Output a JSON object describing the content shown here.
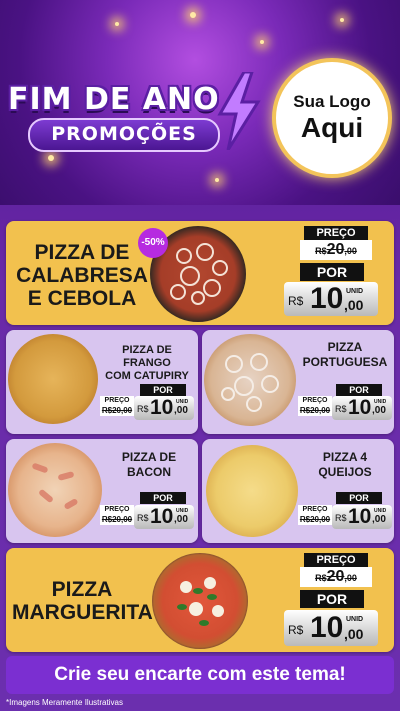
{
  "header": {
    "title_line1": "FIM DE ANO",
    "title_line2": "PROMOÇÕES",
    "logo_line1": "Sua Logo",
    "logo_line2": "Aqui"
  },
  "featured": [
    {
      "name_lines": [
        "PIZZA DE",
        "CALABRESA",
        "E CEBOLA"
      ],
      "badge": "-50%",
      "preco_label": "PREÇO",
      "old_currency": "R$",
      "old_int": "20",
      "old_dec": ",00",
      "por_label": "POR",
      "currency": "R$",
      "price_int": "10",
      "price_dec": ",00",
      "unid": "UNID"
    },
    {
      "name_lines": [
        "PIZZA",
        "MARGUERITA"
      ],
      "preco_label": "PREÇO",
      "old_currency": "R$",
      "old_int": "20",
      "old_dec": ",00",
      "por_label": "POR",
      "currency": "R$",
      "price_int": "10",
      "price_dec": ",00",
      "unid": "UNID"
    }
  ],
  "small": [
    {
      "name_lines": [
        "PIZZA DE FRANGO",
        "COM CATUPIRY"
      ],
      "preco_label": "PREÇO",
      "old": "R$20,00",
      "por_label": "POR",
      "currency": "R$",
      "price_int": "10",
      "price_dec": ",00",
      "unid": "UNID"
    },
    {
      "name_lines": [
        "PIZZA",
        "PORTUGUESA"
      ],
      "preco_label": "PREÇO",
      "old": "R$20,00",
      "por_label": "POR",
      "currency": "R$",
      "price_int": "10",
      "price_dec": ",00",
      "unid": "UNID"
    },
    {
      "name_lines": [
        "PIZZA DE",
        "BACON"
      ],
      "preco_label": "PREÇO",
      "old": "R$20,00",
      "por_label": "POR",
      "currency": "R$",
      "price_int": "10",
      "price_dec": ",00",
      "unid": "UNID"
    },
    {
      "name_lines": [
        "PIZZA 4",
        "QUEIJOS"
      ],
      "preco_label": "PREÇO",
      "old": "R$20,00",
      "por_label": "POR",
      "currency": "R$",
      "price_int": "10",
      "price_dec": ",00",
      "unid": "UNID"
    }
  ],
  "cta": "Crie seu encarte com este tema!",
  "note": "*Imagens Meramente Ilustrativas",
  "colors": {
    "gold": "#f2c14e",
    "lavender": "#d8c5ef",
    "purple": "#7b2fd1"
  }
}
